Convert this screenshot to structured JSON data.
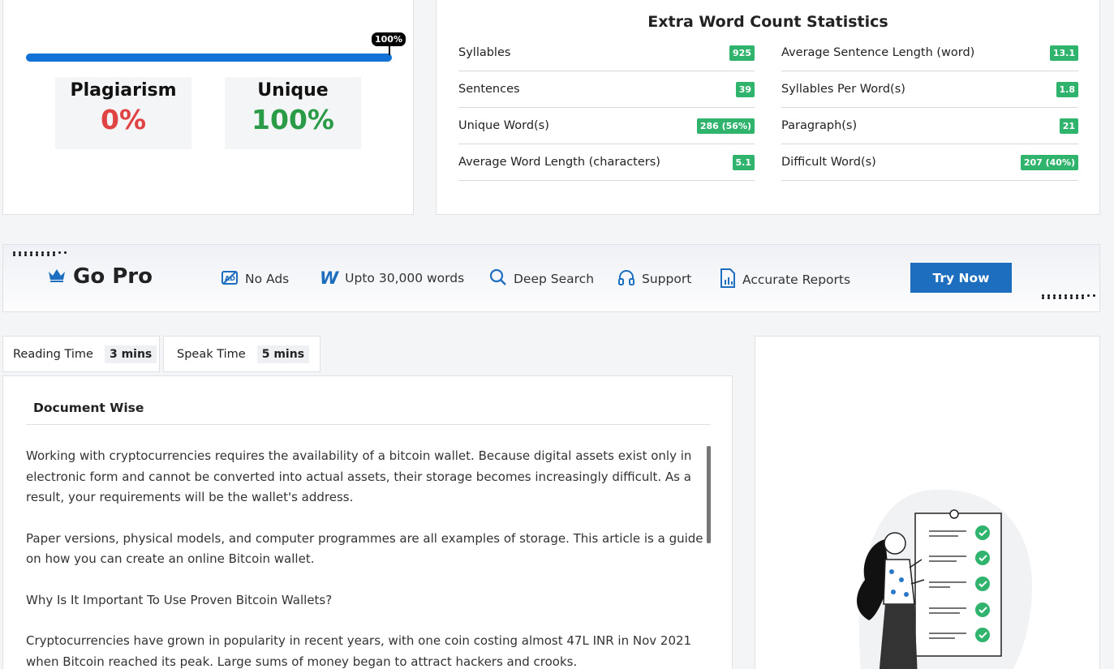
{
  "plagiarism_check": {
    "progress_percent": 100,
    "progress_label": "100%",
    "plagiarism_label": "Plagiarism",
    "plagiarism_value": "0%",
    "unique_label": "Unique",
    "unique_value": "100%"
  },
  "extra_stats": {
    "title": "Extra Word Count Statistics",
    "left": [
      {
        "label": "Syllables",
        "value": "925"
      },
      {
        "label": "Sentences",
        "value": "39"
      },
      {
        "label": "Unique Word(s)",
        "value": "286 (56%)"
      },
      {
        "label": "Average Word Length (characters)",
        "value": "5.1"
      }
    ],
    "right": [
      {
        "label": "Average Sentence Length (word)",
        "value": "13.1"
      },
      {
        "label": "Syllables Per Word(s)",
        "value": "1.8"
      },
      {
        "label": "Paragraph(s)",
        "value": "21"
      },
      {
        "label": "Difficult Word(s)",
        "value": "207 (40%)"
      }
    ]
  },
  "go_pro": {
    "title": "Go Pro",
    "features": [
      {
        "label": "No Ads",
        "icon": "no-ads-icon"
      },
      {
        "label": "Upto 30,000 words",
        "icon": "w-icon"
      },
      {
        "label": "Deep Search",
        "icon": "search-icon"
      },
      {
        "label": "Support",
        "icon": "headphones-icon"
      },
      {
        "label": "Accurate Reports",
        "icon": "report-icon"
      }
    ],
    "button_label": "Try Now"
  },
  "times": {
    "reading_label": "Reading Time",
    "reading_value": "3 mins",
    "speak_label": "Speak Time",
    "speak_value": "5 mins"
  },
  "document": {
    "heading": "Document Wise",
    "paragraphs": [
      "Working with cryptocurrencies requires the availability of a bitcoin wallet. Because digital assets exist only in electronic form and cannot be converted into actual assets, their storage becomes increasingly difficult. As a result, your requirements will be the wallet's address.",
      "Paper versions, physical models, and computer programmes are all examples of storage. This article is a guide on how you can create an online Bitcoin wallet.",
      "Why Is It Important To Use Proven Bitcoin Wallets?",
      "Cryptocurrencies have grown in popularity in recent years, with one coin costing almost 47L INR in Nov 2021 when Bitcoin reached its peak. Large sums of money began to attract hackers and crooks."
    ]
  },
  "colors": {
    "accent_blue": "#1272d6",
    "badge_green": "#2fb36d",
    "plagiarism_red": "#e04343",
    "unique_green": "#2a9b47",
    "button_blue": "#1d6ebf"
  }
}
